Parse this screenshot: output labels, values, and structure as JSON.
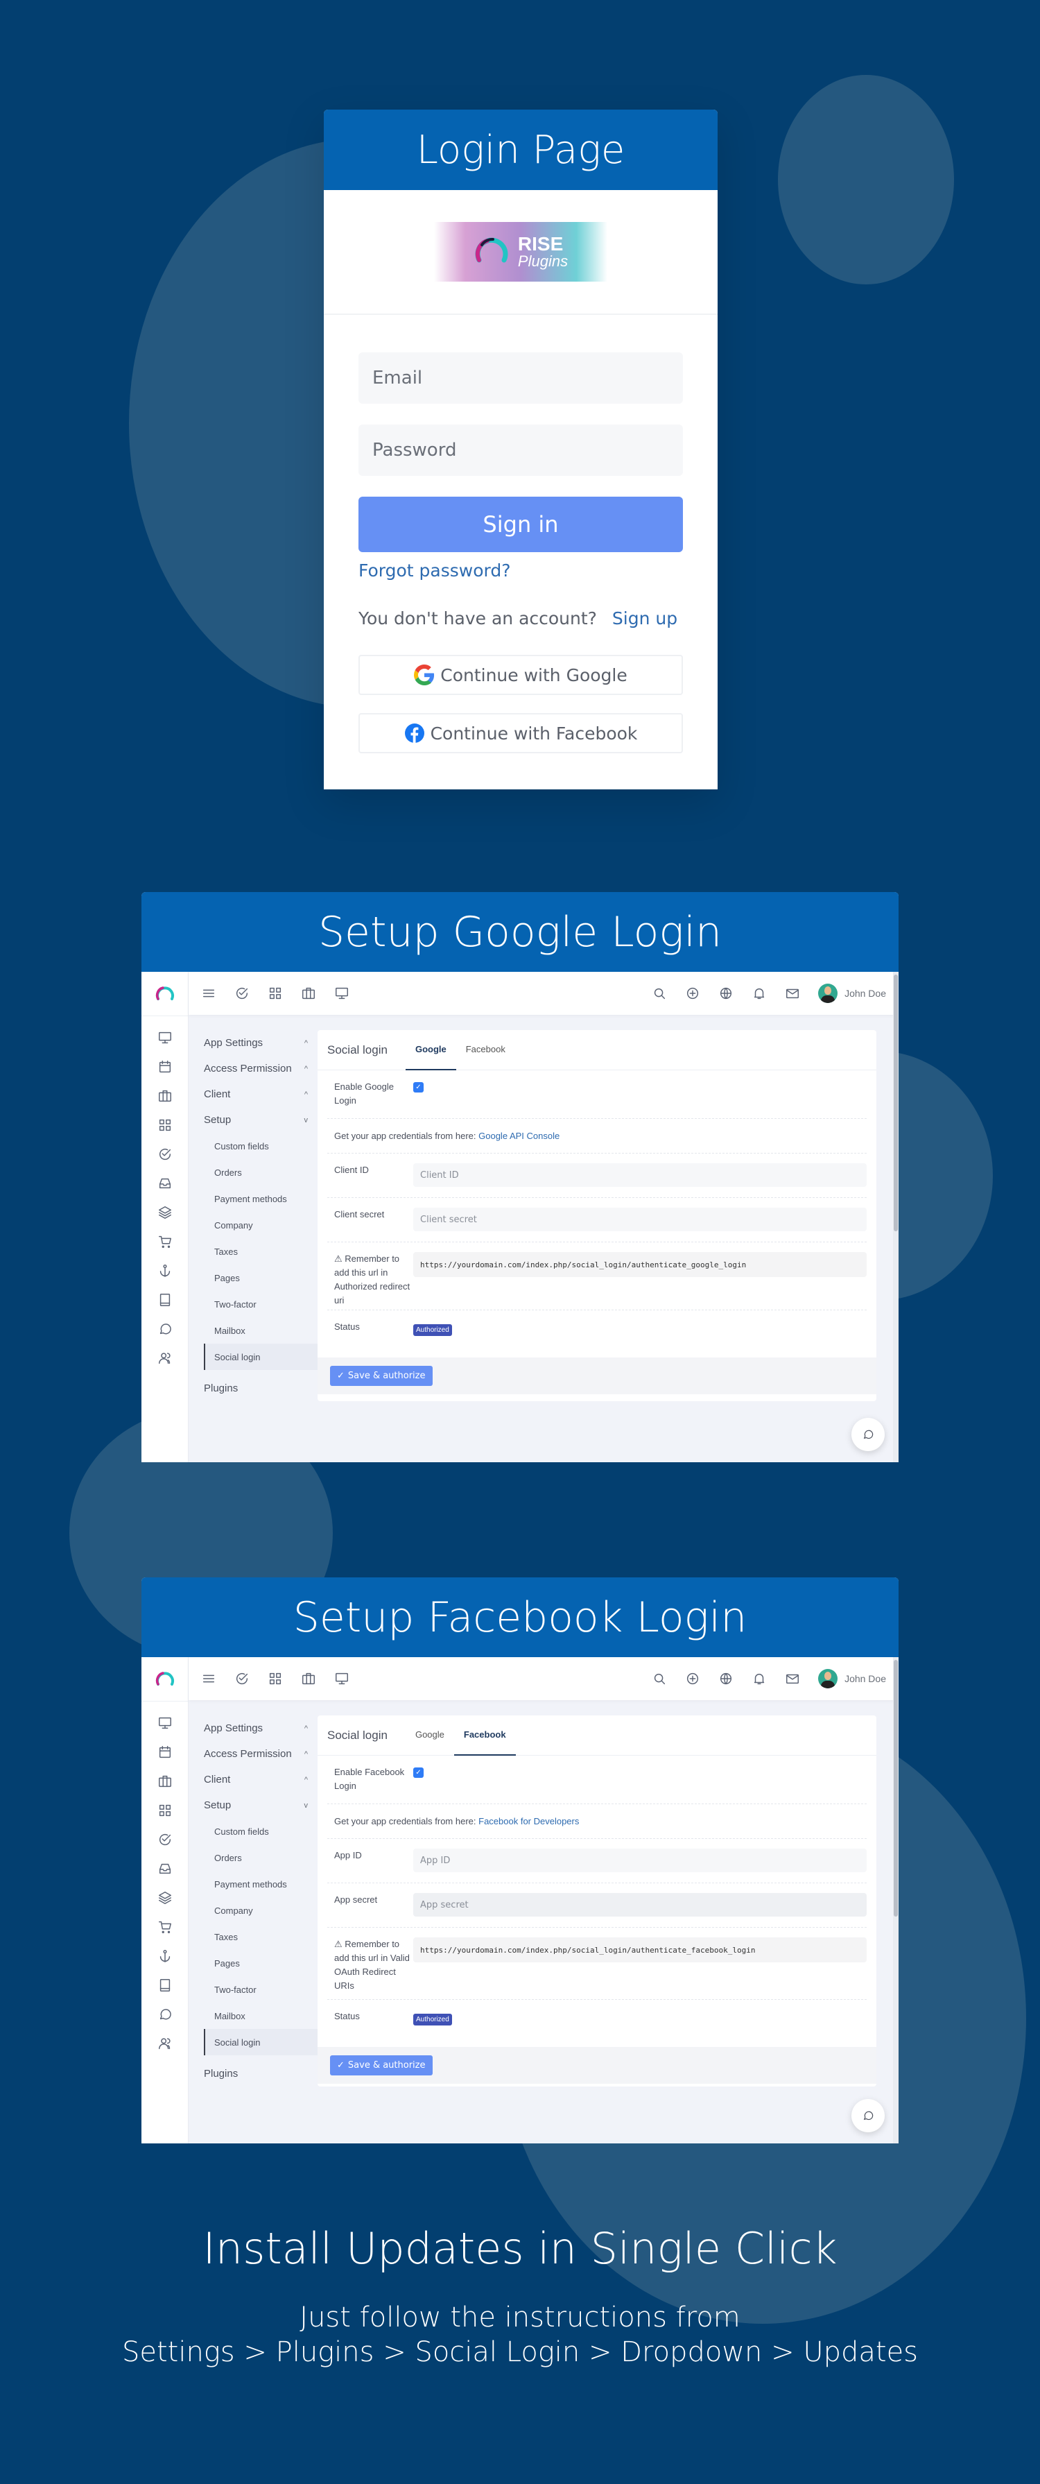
{
  "login_section": {
    "title": "Login Page",
    "logo": {
      "line1": "RISE",
      "line2": "Plugins"
    },
    "email_placeholder": "Email",
    "password_placeholder": "Password",
    "signin_label": "Sign in",
    "forgot_label": "Forgot password?",
    "no_account_text": "You don't have an account?",
    "signup_label": "Sign up",
    "google_button": "Continue with Google",
    "facebook_button": "Continue with Facebook"
  },
  "app_shell": {
    "user_name": "John Doe",
    "topbar_left_icons": [
      "menu-icon",
      "check-circle-icon",
      "grid-icon",
      "briefcase-icon",
      "monitor-icon"
    ],
    "topbar_right_icons": [
      "search-icon",
      "plus-circle-icon",
      "globe-icon",
      "bell-icon",
      "mail-icon"
    ],
    "rail_icons": [
      "monitor-icon",
      "calendar-icon",
      "briefcase-icon",
      "grid-icon",
      "check-circle-icon",
      "inbox-icon",
      "layers-icon",
      "cart-icon",
      "anchor-icon",
      "book-icon",
      "chat-icon",
      "users-icon"
    ],
    "nav_groups": [
      {
        "label": "App Settings",
        "chevron": "^"
      },
      {
        "label": "Access Permission",
        "chevron": "^"
      },
      {
        "label": "Client",
        "chevron": "^"
      },
      {
        "label": "Setup",
        "chevron": "v"
      }
    ],
    "nav_sub_items": [
      "Custom fields",
      "Orders",
      "Payment methods",
      "Company",
      "Taxes",
      "Pages",
      "Two-factor",
      "Mailbox",
      "Social login"
    ],
    "active_sub_item": "Social login",
    "nav_plugins": "Plugins",
    "card_title": "Social login",
    "tabs": [
      "Google",
      "Facebook"
    ],
    "status_label": "Status",
    "status_value": "Authorized",
    "save_button": "Save & authorize",
    "credentials_prefix": "Get your app credentials from here:"
  },
  "google_section": {
    "title": "Setup Google Login",
    "active_tab": "Google",
    "enable_label": "Enable Google Login",
    "enabled": true,
    "credentials_link": "Google API Console",
    "field1_label": "Client ID",
    "field1_placeholder": "Client ID",
    "field2_label": "Client secret",
    "field2_placeholder": "Client secret",
    "remember_label": "Remember to add this url in Authorized redirect uri",
    "redirect_url": "https://yourdomain.com/index.php/social_login/authenticate_google_login"
  },
  "facebook_section": {
    "title": "Setup Facebook Login",
    "active_tab": "Facebook",
    "enable_label": "Enable Facebook Login",
    "enabled": true,
    "credentials_link": "Facebook for Developers",
    "field1_label": "App ID",
    "field1_placeholder": "App ID",
    "field2_label": "App secret",
    "field2_placeholder": "App secret",
    "remember_label": "Remember to add this url in Valid OAuth Redirect URIs",
    "redirect_url": "https://yourdomain.com/index.php/social_login/authenticate_facebook_login"
  },
  "updates_section": {
    "title": "Install Updates in Single Click",
    "line1": "Just follow the instructions from",
    "line2": "Settings > Plugins > Social Login > Dropdown > Updates"
  },
  "colors": {
    "background": "#033f70",
    "header_blue": "#0563b1",
    "button_blue": "#6690f4",
    "link_blue": "#2e6bb0",
    "badge": "#3f51b5"
  }
}
